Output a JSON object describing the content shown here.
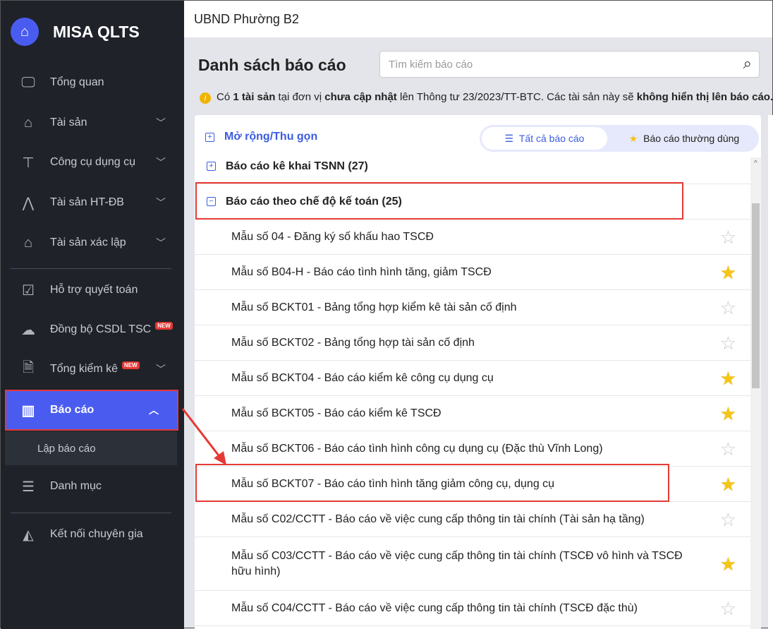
{
  "app": {
    "brand": "MISA QLTS",
    "org": "UBND Phường B2"
  },
  "sidebar": {
    "items": [
      {
        "label": "Tổng quan",
        "icon": "monitor-chart-icon"
      },
      {
        "label": "Tài sản",
        "icon": "house-car-icon",
        "chevron": true
      },
      {
        "label": "Công cụ dụng cụ",
        "icon": "paint-roller-icon",
        "chevron": true
      },
      {
        "label": "Tài sản HT-ĐB",
        "icon": "road-icon",
        "chevron": true
      },
      {
        "label": "Tài sản xác lập",
        "icon": "house-car-icon",
        "chevron": true
      },
      {
        "label": "Hỗ trợ quyết toán",
        "icon": "checklist-icon"
      },
      {
        "label": "Đồng bộ CSDL TSC",
        "icon": "cloud-upload-icon",
        "badge": "NEW"
      },
      {
        "label": "Tổng kiểm kê",
        "icon": "document-check-icon",
        "badge": "NEW",
        "chevron": true
      },
      {
        "label": "Báo cáo",
        "icon": "bar-chart-icon",
        "active": true
      },
      {
        "label": "Danh mục",
        "icon": "list-icon"
      },
      {
        "label": "Kết nối chuyên gia",
        "icon": "expert-icon"
      }
    ],
    "sub_item": "Lập báo cáo"
  },
  "main": {
    "title": "Danh sách báo cáo",
    "search_placeholder": "Tìm kiếm báo cáo",
    "notice": {
      "t1": "Có ",
      "b1": "1 tài sản",
      "t2": " tại đơn vị ",
      "b2": "chưa cập nhật",
      "t3": " lên Thông tư 23/2023/TT-BTC. Các tài sản này sẽ ",
      "b3": "không hiển thị lên báo cáo."
    },
    "expand_label": "Mở rộng/Thu gọn",
    "tabs": {
      "all": "Tất cả báo cáo",
      "favorite": "Báo cáo thường dùng"
    },
    "groups": [
      {
        "label": "Báo cáo kê khai TSNN (27)"
      },
      {
        "label": "Báo cáo theo chế độ kế toán (25)"
      }
    ],
    "reports": [
      {
        "label": "Mẫu số 04 - Đăng ký số khấu hao TSCĐ",
        "fav": false
      },
      {
        "label": "Mẫu số B04-H - Báo cáo tình hình tăng, giảm TSCĐ",
        "fav": true
      },
      {
        "label": "Mẫu số BCKT01 - Bảng tổng hợp kiểm kê tài sản cố định",
        "fav": false
      },
      {
        "label": "Mẫu số BCKT02 - Bảng tổng hợp tài sản cố định",
        "fav": false
      },
      {
        "label": "Mẫu số BCKT04 - Báo cáo kiểm kê công cụ dụng cụ",
        "fav": true
      },
      {
        "label": "Mẫu số BCKT05 - Báo cáo kiểm kê TSCĐ",
        "fav": true
      },
      {
        "label": "Mẫu số BCKT06 - Báo cáo tình hình công cụ dụng cụ (Đặc thù Vĩnh Long)",
        "fav": false
      },
      {
        "label": "Mẫu số BCKT07 - Báo cáo tình hình tăng giảm công cụ, dụng cụ",
        "fav": true
      },
      {
        "label": "Mẫu số C02/CCTT - Báo cáo về việc cung cấp thông tin tài chính (Tài sản hạ tầng)",
        "fav": false
      },
      {
        "label": "Mẫu số C03/CCTT - Báo cáo về việc cung cấp thông tin tài chính (TSCĐ vô hình và TSCĐ hữu hình)",
        "fav": true
      },
      {
        "label": "Mẫu số C04/CCTT - Báo cáo về việc cung cấp thông tin tài chính (TSCĐ đặc thù)",
        "fav": false
      }
    ]
  }
}
